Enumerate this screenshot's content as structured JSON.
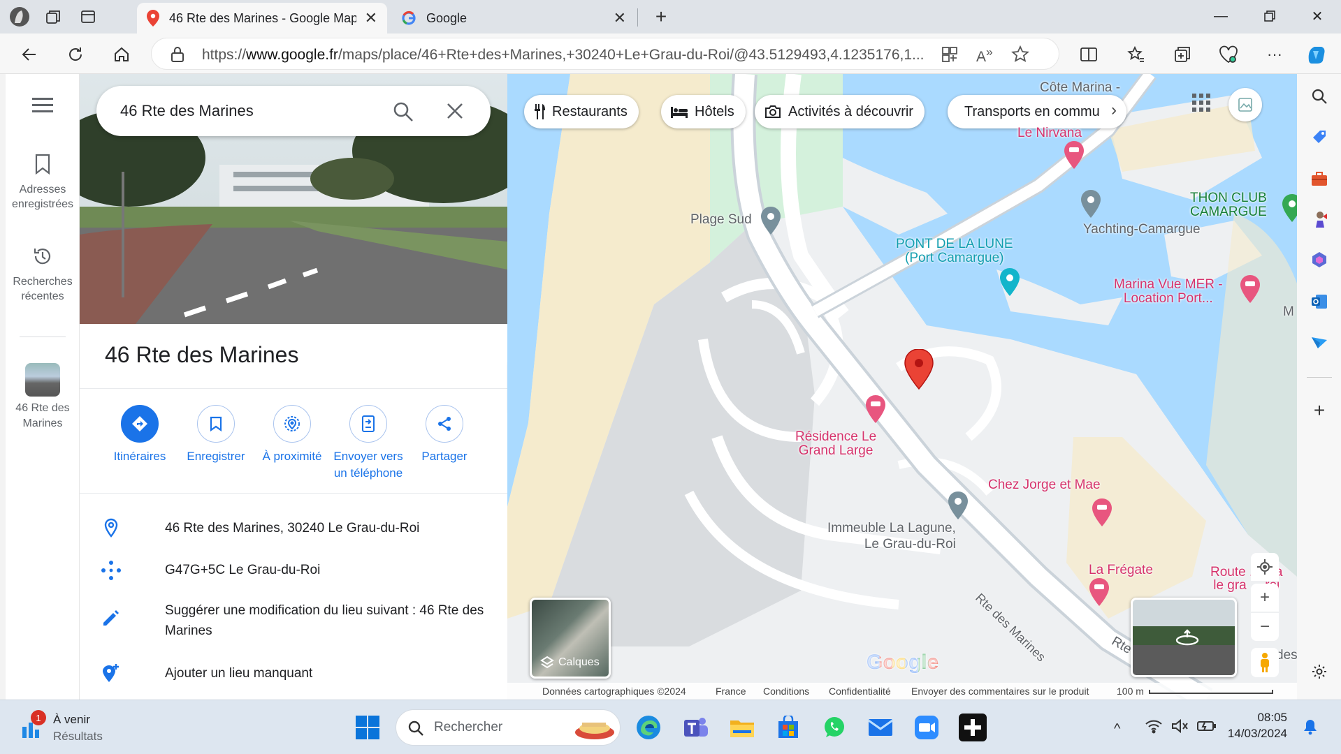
{
  "browser": {
    "tabs": [
      {
        "title": "46 Rte des Marines - Google Maps",
        "icon": "google-maps-pin-icon",
        "active": true
      },
      {
        "title": "Google",
        "icon": "google-g-icon",
        "active": false
      }
    ],
    "url_prefix": "https://",
    "url_domain": "www.google.fr",
    "url_path": "/maps/place/46+Rte+des+Marines,+30240+Le+Grau-du-Roi/@43.5129493,4.1235176,1..."
  },
  "rail": {
    "saved_label": "Adresses enregistrées",
    "recent_label": "Recherches récentes",
    "place_label": "46 Rte des Marines"
  },
  "panel": {
    "search_value": "46 Rte des Marines",
    "title": "46 Rte des Marines",
    "actions": [
      {
        "label": "Itinéraires",
        "icon": "directions-icon"
      },
      {
        "label": "Enregistrer",
        "icon": "bookmark-icon"
      },
      {
        "label": "À proximité",
        "icon": "nearby-icon"
      },
      {
        "label": "Envoyer vers un téléphone",
        "icon": "send-to-phone-icon"
      },
      {
        "label": "Partager",
        "icon": "share-icon"
      }
    ],
    "info": [
      {
        "text": "46 Rte des Marines, 30240 Le Grau-du-Roi",
        "icon": "location-pin-icon"
      },
      {
        "text": "G47G+5C Le Grau-du-Roi",
        "icon": "plus-code-icon"
      },
      {
        "text": "Suggérer une modification du lieu suivant : 46 Rte des Marines",
        "icon": "edit-pencil-icon"
      },
      {
        "text": "Ajouter un lieu manquant",
        "icon": "add-place-icon"
      }
    ]
  },
  "map": {
    "chips": [
      {
        "label": "Restaurants",
        "icon": "restaurant-icon"
      },
      {
        "label": "Hôtels",
        "icon": "hotel-icon"
      },
      {
        "label": "Activités à découvrir",
        "icon": "camera-icon"
      },
      {
        "label": "Transports en commu",
        "icon": "transit-icon"
      }
    ],
    "labels": {
      "cote_marina": "Côte Marina -",
      "le_nirvana": "Le Nirvana",
      "plage_sud": "Plage Sud",
      "thon_club_1": "THON CLUB",
      "thon_club_2": "CAMARGUE",
      "yachting": "Yachting-Camargue",
      "pont_1": "PONT DE LA LUNE",
      "pont_2": "(Port Camargue)",
      "marina_1": "Marina Vue MER -",
      "marina_2": "Location Port...",
      "residence_1": "Résidence Le",
      "residence_2": "Grand Large",
      "chez_jorge": "Chez Jorge et Mae",
      "immeuble_1": "Immeuble La Lagune,",
      "immeuble_2": "Le Grau-du-Roi",
      "rte_des_marines": "Rte des Marines",
      "la_fregate": "La Frégate",
      "route_1": "Route ... ma",
      "route_2": "le gra ... roi",
      "m_edge": "M",
      "des_edge": "des",
      "rte_edge": "Rte"
    },
    "layers_label": "Calques",
    "google_logo": "Google",
    "footer": {
      "data": "Données cartographiques ©2024",
      "country": "France",
      "terms": "Conditions",
      "privacy": "Confidentialité",
      "feedback": "Envoyer des commentaires sur le produit",
      "scale": "100 m"
    }
  },
  "taskbar": {
    "widget_title": "À venir",
    "widget_sub": "Résultats",
    "widget_badge": "1",
    "search_placeholder": "Rechercher",
    "time": "08:05",
    "date": "14/03/2024"
  },
  "colors": {
    "water": "#aadaff",
    "sand": "#f5ebcd",
    "land": "#eef0f2",
    "park": "#d4f1dc",
    "accent": "#1a73e8",
    "pin": "#ea4335"
  }
}
